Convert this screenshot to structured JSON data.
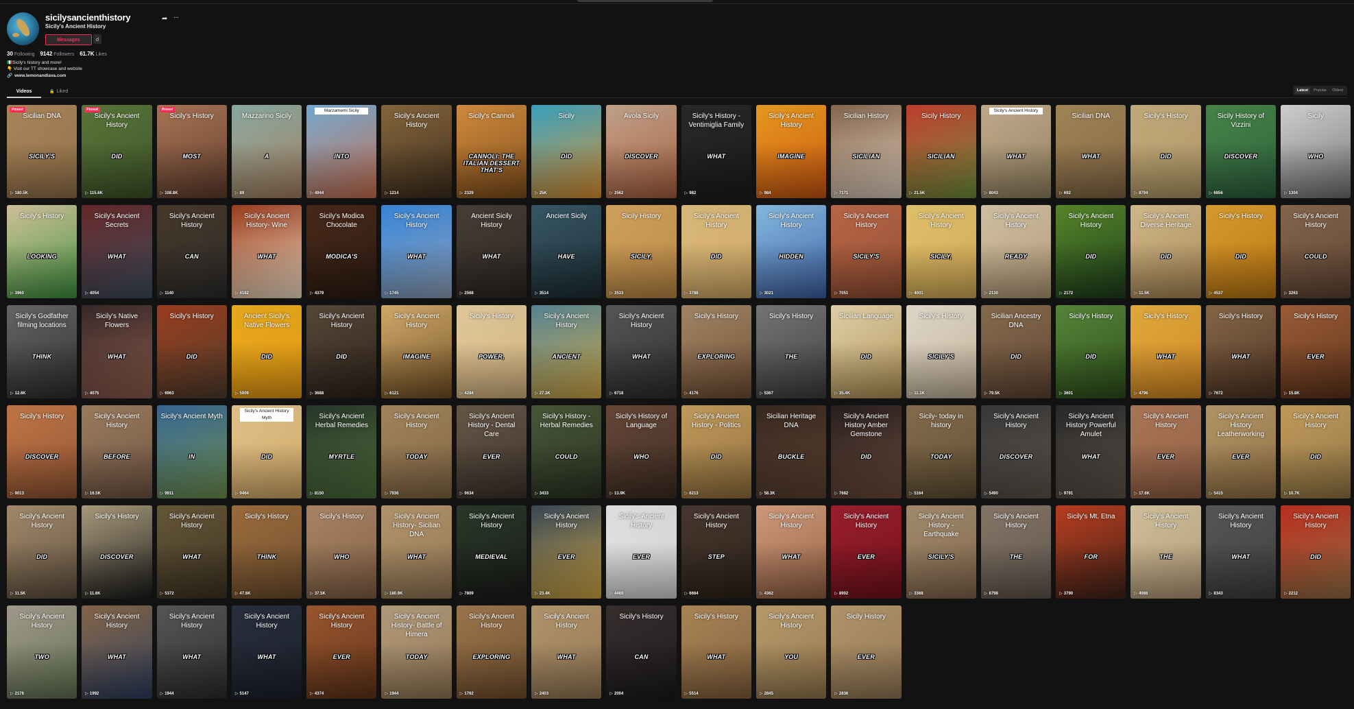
{
  "profile": {
    "username": "sicilysancienthistory",
    "nickname": "Sicily's Ancient History",
    "messages_label": "Messages",
    "stats": [
      {
        "value": "30",
        "label": "Following"
      },
      {
        "value": "9142",
        "label": "Followers"
      },
      {
        "value": "61.7K",
        "label": "Likes"
      }
    ],
    "bio_lines": [
      "🇮🇹Sicily's history and more!",
      "👇 Visit our TT showcase and website"
    ],
    "link": "www.lemonandlava.com"
  },
  "tabs": {
    "videos": "Videos",
    "liked": "Liked"
  },
  "sort": [
    "Latest",
    "Popular",
    "Oldest"
  ],
  "pinned_label": "Pinned",
  "videos": [
    {
      "title": "Sicilian DNA",
      "caption": "SICILY'S",
      "views": "180.5K",
      "pinned": true,
      "bg": "#b08a5e,#8a6a44"
    },
    {
      "title": "Sicily's Ancient History",
      "caption": "DID",
      "views": "115.6K",
      "pinned": true,
      "bg": "#5c7a3c,#3a4f26"
    },
    {
      "title": "Sicily's History",
      "caption": "MOST",
      "views": "108.8K",
      "pinned": true,
      "bg": "#b07858,#5a3a2a"
    },
    {
      "title": "Mazzarino Sicily",
      "caption": "A",
      "views": "89",
      "bg": "#8fb0a8,#a07a5a"
    },
    {
      "title": "Marzamemi Sicily",
      "caption": "INTO",
      "views": "4944",
      "boxed": true,
      "bg": "#7ab0d8,#c06a4a"
    },
    {
      "title": "Sicily's Ancient History",
      "caption": "",
      "views": "1214",
      "bg": "#8a6a40,#3a2a1a"
    },
    {
      "title": "Sicily's Cannoli",
      "caption": "CANNOLI: THE ITALIAN DESSERT THAT'S",
      "views": "2329",
      "bg": "#d89040,#7a4a1a"
    },
    {
      "title": "Sicily",
      "caption": "DID",
      "views": "25K",
      "bg": "#3aa8c8,#d88a2a"
    },
    {
      "title": "Avola Sicily",
      "caption": "DISCOVER",
      "views": "2562",
      "bg": "#c8a890,#a05a3a"
    },
    {
      "title": "Sicily's History - Ventimiglia Family",
      "caption": "WHAT",
      "views": "982",
      "bg": "#2a2a2a,#1a1a1a"
    },
    {
      "title": "Sicily's Ancient History",
      "caption": "IMAGINE",
      "views": "984",
      "bg": "#f0a020,#c05010"
    },
    {
      "title": "Sicilian History",
      "caption": "SICILIAN",
      "views": "7171",
      "bg": "#8a6a50,#d8c8b8"
    },
    {
      "title": "Sicily History",
      "caption": "SICILIAN",
      "views": "21.5K",
      "bg": "#c84030,#6a8a3a"
    },
    {
      "title": "Sicily's Ancient History",
      "caption": "WHAT",
      "views": "8043",
      "boxed": true,
      "bg": "#c8b090,#8a7a5a"
    },
    {
      "title": "Sicilian DNA",
      "caption": "WHAT",
      "views": "692",
      "bg": "#a88a5a,#7a6040"
    },
    {
      "title": "Sicily's History",
      "caption": "DID",
      "views": "8794",
      "bg": "#c8b080,#a89060"
    },
    {
      "title": "Sicily History of Vizzini",
      "caption": "DISCOVER",
      "views": "6856",
      "bg": "#4a8a4a,#2a5a3a"
    },
    {
      "title": "Sicily",
      "caption": "WHO",
      "views": "1304",
      "bg": "#d8d8d8,#6a6a6a"
    },
    {
      "title": "Sicily's History",
      "caption": "LOOKING",
      "views": "3960",
      "bg": "#d8c8a0,#3a8a3a"
    },
    {
      "title": "Sicily's Ancient Secrets",
      "caption": "WHAT",
      "views": "4054",
      "bg": "#6a2a2a,#3a4a5a"
    },
    {
      "title": "Sicily's Ancient History",
      "caption": "CAN",
      "views": "1140",
      "bg": "#4a3a2a,#2a2a2a"
    },
    {
      "title": "Sicily's Ancient History- Wine",
      "caption": "WHAT",
      "views": "4182",
      "bg": "#a04020,#e8d8c0"
    },
    {
      "title": "Sicily's Modica Chocolate",
      "caption": "MODICA'S",
      "views": "4379",
      "bg": "#4a2a1a,#2a1a10"
    },
    {
      "title": "Sicily's Ancient History",
      "caption": "WHAT",
      "views": "1745",
      "bg": "#3a8ae0,#8a9ab0"
    },
    {
      "title": "Ancient Sicily History",
      "caption": "WHAT",
      "views": "2568",
      "bg": "#4a4038,#2a2420"
    },
    {
      "title": "Ancient Sicily",
      "caption": "HAVE",
      "views": "3514",
      "bg": "#3a5a6a,#1a2a30"
    },
    {
      "title": "Sicily History",
      "caption": "SICILY,",
      "views": "3533",
      "bg": "#d8a860,#b08040"
    },
    {
      "title": "Sicily's Ancient History",
      "caption": "DID",
      "views": "3788",
      "bg": "#e0c080,#c8a060"
    },
    {
      "title": "Sicily's Ancient History",
      "caption": "HIDDEN",
      "views": "3021",
      "bg": "#8ac0e8,#3a5a9a"
    },
    {
      "title": "Sicily's Ancient History",
      "caption": "SICILY'S",
      "views": "7051",
      "bg": "#c06a4a,#8a4a30"
    },
    {
      "title": "Sicily's Ancient History",
      "caption": "SICILY,",
      "views": "4001",
      "bg": "#e8c870,#c8a050"
    },
    {
      "title": "Sicily's Ancient History",
      "caption": "READY",
      "views": "2130",
      "bg": "#d8c8a8,#a89070"
    },
    {
      "title": "Sicily's Ancient History",
      "caption": "DID",
      "views": "2172",
      "bg": "#5a8a2a,#1a3a1a"
    },
    {
      "title": "Sicily's Ancient Diverse Heritage",
      "caption": "DID",
      "views": "11.5K",
      "bg": "#d8c090,#a08050"
    },
    {
      "title": "Sicily's History",
      "caption": "DID",
      "views": "4537",
      "bg": "#e0a030,#b07010"
    },
    {
      "title": "Sicily's Ancient History",
      "caption": "COULD",
      "views": "3263",
      "bg": "#8a6a50,#5a4030"
    },
    {
      "title": "Sicily's Godfather filming locations",
      "caption": "THINK",
      "views": "12.6K",
      "bg": "#6a6a6a,#2a2a2a"
    },
    {
      "title": "Sicily's Native Flowers",
      "caption": "WHAT",
      "views": "4075",
      "bg": "#3a2a2a,#8a5a4a"
    },
    {
      "title": "Sicily's History",
      "caption": "DID",
      "views": "6963",
      "bg": "#a04020,#4a3a2a"
    },
    {
      "title": "Ancient Sicily's Native Flowers",
      "caption": "DID",
      "views": "5909",
      "bg": "#f0b020,#d89010"
    },
    {
      "title": "Sicily's Ancient History",
      "caption": "DID",
      "views": "3688",
      "bg": "#5a4a3a,#2a2018"
    },
    {
      "title": "Sicily's Ancient History",
      "caption": "IMAGINE",
      "views": "6121",
      "bg": "#d8b070,#6a4a20"
    },
    {
      "title": "Sicily's History",
      "caption": "POWER,",
      "views": "4284",
      "bg": "#e8d0a0,#c8a878"
    },
    {
      "title": "Sicily's Ancient History",
      "caption": "ANCIENT",
      "views": "27.3K",
      "bg": "#5a8a9a,#c8a040"
    },
    {
      "title": "Sicily's Ancient History",
      "caption": "WHAT",
      "views": "6718",
      "bg": "#5a5a5a,#2a2a2a"
    },
    {
      "title": "Sicily's History",
      "caption": "EXPLORING",
      "views": "4176",
      "bg": "#a88a6a,#6a4a30"
    },
    {
      "title": "Sicily's History",
      "caption": "THE",
      "views": "5367",
      "bg": "#7a7a7a,#3a3a3a"
    },
    {
      "title": "Sicilian Language",
      "caption": "DID",
      "views": "35.4K",
      "bg": "#e8d8b0,#a88a50"
    },
    {
      "title": "Sicily's History",
      "caption": "SICILY'S",
      "views": "11.1K",
      "bg": "#e8e0d0,#b8a890"
    },
    {
      "title": "Sicilian Ancestry DNA",
      "caption": "DID",
      "views": "79.5K",
      "bg": "#8a7050,#5a4030"
    },
    {
      "title": "Sicily's History",
      "caption": "DID",
      "views": "3601",
      "bg": "#5a8a3a,#2a4a1a"
    },
    {
      "title": "Sicily's History",
      "caption": "WHAT",
      "views": "4796",
      "bg": "#e8b040,#c88020"
    },
    {
      "title": "Sicily's History",
      "caption": "WHAT",
      "views": "7672",
      "bg": "#8a6a4a,#4a3020"
    },
    {
      "title": "Sicily's History",
      "caption": "EVER",
      "views": "15.8K",
      "bg": "#a0603a,#5a3018"
    },
    {
      "title": "Sicily's History",
      "caption": "DISCOVER",
      "views": "9013",
      "bg": "#c87a4a,#8a5030"
    },
    {
      "title": "Sicily's Ancient History",
      "caption": "BEFORE",
      "views": "16.5K",
      "bg": "#a08060,#6a5040"
    },
    {
      "title": "Sicily's Ancient Myth",
      "caption": "IN",
      "views": "9911",
      "bg": "#3a6a9a,#6a8a4a"
    },
    {
      "title": "Sicily's Ancient History Myth",
      "caption": "DID",
      "views": "9464",
      "boxed": true,
      "bg": "#e8c890,#c8a060"
    },
    {
      "title": "Sicily's Ancient Herbal Remedies",
      "caption": "MYRTLE",
      "views": "8150",
      "bg": "#2a3a2a,#4a6a3a"
    },
    {
      "title": "Sicily's Ancient History",
      "caption": "TODAY",
      "views": "7936",
      "bg": "#a88a60,#7a6040"
    },
    {
      "title": "Sicily's Ancient History - Dental Care",
      "caption": "EVER",
      "views": "9634",
      "bg": "#6a5a4a,#3a3028"
    },
    {
      "title": "Sicily's History - Herbal Remedies",
      "caption": "COULD",
      "views": "3433",
      "bg": "#4a5a3a,#2a3020"
    },
    {
      "title": "Sicily's History of Language",
      "caption": "WHO",
      "views": "13.9K",
      "bg": "#6a4a3a,#3a2a20"
    },
    {
      "title": "Sicily's Ancient History - Politics",
      "caption": "DID",
      "views": "6213",
      "bg": "#c8a060,#8a6a3a"
    },
    {
      "title": "Sicilian Heritage DNA",
      "caption": "BUCKLE",
      "views": "58.3K",
      "bg": "#3a2a20,#5a4030"
    },
    {
      "title": "Sicily's Ancient History Amber Gemstone",
      "caption": "DID",
      "views": "7682",
      "bg": "#2a2020,#6a4a3a"
    },
    {
      "title": "Sicily- today in history",
      "caption": "TODAY",
      "views": "5164",
      "bg": "#8a7050,#5a4a30"
    },
    {
      "title": "Sicily's Ancient History",
      "caption": "DISCOVER",
      "views": "5490",
      "bg": "#3a3a3a,#5a5048"
    },
    {
      "title": "Sicily's Ancient History Powerful Amulet",
      "caption": "WHAT",
      "views": "9791",
      "bg": "#2a2a2a,#5a5048"
    },
    {
      "title": "Sicily's Ancient History",
      "caption": "EVER",
      "views": "17.6K",
      "bg": "#b07a5a,#8a5a40"
    },
    {
      "title": "Sicily's Ancient History Leatherworking",
      "caption": "EVER",
      "views": "5415",
      "bg": "#b89a6a,#8a6a40"
    },
    {
      "title": "Sicily's Ancient History",
      "caption": "DID",
      "views": "10.7K",
      "bg": "#c8a060,#8a7040"
    },
    {
      "title": "Sicily's Ancient History",
      "caption": "DID",
      "views": "11.5K",
      "bg": "#a89070,#5a4a3a"
    },
    {
      "title": "Sicily's History",
      "caption": "DISCOVER",
      "views": "11.6K",
      "bg": "#b0a080,#1a1a1a"
    },
    {
      "title": "Sicily's Ancient History",
      "caption": "WHAT",
      "views": "5372",
      "bg": "#6a5a3a,#3a3020"
    },
    {
      "title": "Sicily's History",
      "caption": "THINK",
      "views": "47.6K",
      "bg": "#a07040,#6a4a2a"
    },
    {
      "title": "Sicily's History",
      "caption": "WHO",
      "views": "37.5K",
      "bg": "#b08a6a,#7a5a40"
    },
    {
      "title": "Sicily's Ancient History- Sicilian DNA",
      "caption": "WHAT",
      "views": "180.9K",
      "bg": "#b89a70,#8a7050"
    },
    {
      "title": "Sicily's Ancient History",
      "caption": "MEDIEVAL",
      "views": "7809",
      "bg": "#2a3a2a,#1a1a18"
    },
    {
      "title": "Sicily's Ancient History",
      "caption": "EVER",
      "views": "23.4K",
      "bg": "#3a4a5a,#c8a040"
    },
    {
      "title": "Sicily's Ancient History",
      "caption": "EVER",
      "views": "4469",
      "bg": "#e8e8e8,#c8c8c8"
    },
    {
      "title": "Sicily's Ancient History",
      "caption": "STEP",
      "views": "6664",
      "bg": "#4a3a30,#2a2018"
    },
    {
      "title": "Sicily's Ancient History",
      "caption": "WHAT",
      "views": "4362",
      "bg": "#d8a080,#8a5a40"
    },
    {
      "title": "Sicily's Ancient History",
      "caption": "EVER",
      "views": "8902",
      "bg": "#a02030,#6a1018"
    },
    {
      "title": "Sicily's Ancient History - Earthquake",
      "caption": "SICILY'S",
      "views": "3368",
      "bg": "#a89070,#7a6048"
    },
    {
      "title": "Sicily's Ancient History",
      "caption": "THE",
      "views": "8798",
      "bg": "#8a7a6a,#5a5048"
    },
    {
      "title": "Sicily's Mt. Etna",
      "caption": "FOR",
      "views": "3790",
      "bg": "#c04020,#3a2018"
    },
    {
      "title": "Sicily's Ancient History",
      "caption": "THE",
      "views": "4986",
      "bg": "#d8c8a0,#a89070"
    },
    {
      "title": "Sicily's Ancient History",
      "caption": "WHAT",
      "views": "8343",
      "bg": "#5a5a5a,#3a3a3a"
    },
    {
      "title": "Sicily's Ancient History",
      "caption": "DID",
      "views": "2212",
      "bg": "#c03020,#8a6a40"
    },
    {
      "title": "Sicily's Ancient History",
      "caption": "TWO",
      "views": "2176",
      "bg": "#a8a090,#5a6a4a"
    },
    {
      "title": "Sicily's Ancient History",
      "caption": "WHAT",
      "views": "1992",
      "bg": "#8a6a4a,#2a3a5a"
    },
    {
      "title": "Sicily's Ancient History",
      "caption": "WHAT",
      "views": "1944",
      "bg": "#5a5a5a,#2a2a2a"
    },
    {
      "title": "Sicily's Ancient History",
      "caption": "WHAT",
      "views": "5147",
      "bg": "#2a3040,#1a1e28"
    },
    {
      "title": "Sicily's Ancient History",
      "caption": "EVER",
      "views": "4374",
      "bg": "#a05a30,#5a3018"
    },
    {
      "title": "Sicily's Ancient History- Battle of Himera",
      "caption": "TODAY",
      "views": "1944",
      "bg": "#b8a080,#8a7050"
    },
    {
      "title": "Sicily's Ancient History",
      "caption": "EXPLORING",
      "views": "1762",
      "bg": "#a07a50,#6a4a2a"
    },
    {
      "title": "Sicily's  Ancient History",
      "caption": "WHAT",
      "views": "2403",
      "bg": "#b89a70,#8a7050"
    },
    {
      "title": "Sicily's History",
      "caption": "CAN",
      "views": "2004",
      "bg": "#3a3030,#1a1818"
    },
    {
      "title": "Sicily's History",
      "caption": "WHAT",
      "views": "5514",
      "bg": "#b08a5a,#7a5a38"
    },
    {
      "title": "Sicily's Ancient History",
      "caption": "YOU",
      "views": "2845",
      "bg": "#c0a070,#8a7048"
    },
    {
      "title": "Sicily History",
      "caption": "EVER",
      "views": "2836",
      "bg": "#b89a70,#8a7050"
    }
  ]
}
